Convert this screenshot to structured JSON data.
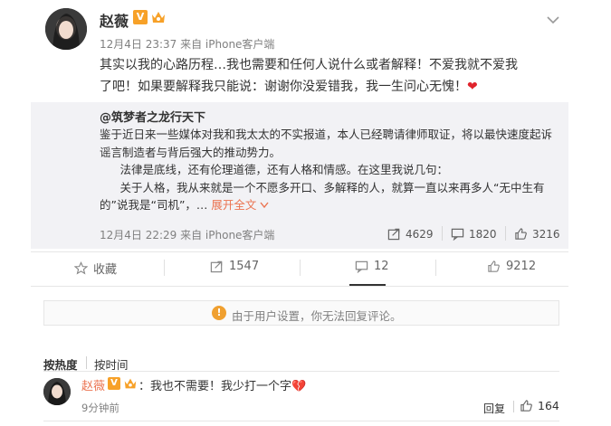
{
  "post": {
    "author": "赵薇",
    "vip_badge": "V",
    "meta": "12月4日 23:37 来自 iPhone客户端",
    "text": "其实以我的心路历程…我也需要和任何人说什么或者解释！不爱我就不爱我了吧！如果要解释我只能说：谢谢你没爱错我，我一生问心无愧！",
    "heart": "❤"
  },
  "repost": {
    "author": "@筑梦者之龙行天下",
    "para1": "鉴于近日来一些媒体对我和我太太的不实报道，本人已经聘请律师取证，将以最快速度起诉谣言制造者与背后强大的推动势力。",
    "para2": "法律是底线，还有伦理道德，还有人格和情感。在这里我说几句：",
    "para3": "关于人格，我从来就是一个不愿多开口、多解释的人，就算一直以来再多人“无中生有的”说我是“司机”，… ",
    "expand": "展开全文",
    "meta": "12月4日 22:29 来自 iPhone客户端",
    "reposts": "4629",
    "comments": "1820",
    "likes": "3216"
  },
  "actions": {
    "favorite": "收藏",
    "repost": "1547",
    "comment": "12",
    "like": "9212"
  },
  "notice": {
    "icon": "!",
    "text": "由于用户设置，你无法回复评论。"
  },
  "sort": {
    "by_hot": "按热度",
    "by_time": "按时间"
  },
  "comment": {
    "author": "赵薇",
    "vip_badge": "V",
    "text": "：我也不需要！我少打一个字",
    "broken_heart": "💔",
    "time": "9分钟前",
    "reply": "回复",
    "likes": "164"
  },
  "icons": {
    "more": "chevron-down-icon",
    "repost": "share-icon",
    "comment": "comment-icon",
    "like": "thumb-up-icon",
    "favorite": "star-icon"
  },
  "colors": {
    "accent": "#eb7350",
    "heart": "#e0242c",
    "badge": "#f7a128",
    "repost_bg": "#f2f2f5"
  }
}
